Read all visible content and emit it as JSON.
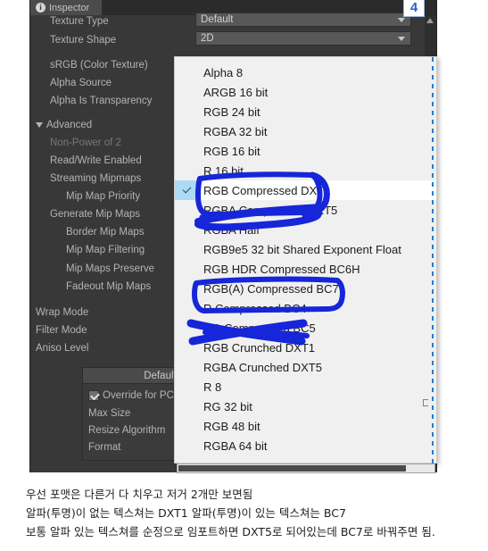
{
  "inspector": {
    "tab_label": "Inspector",
    "tab_icon": "info-icon",
    "properties": [
      {
        "label": "Texture Type",
        "value": "Default",
        "kind": "dropdown"
      },
      {
        "label": "Texture Shape",
        "value": "2D",
        "kind": "dropdown"
      },
      {
        "label": "sRGB (Color Texture)",
        "value": "",
        "kind": "checkbox"
      },
      {
        "label": "Alpha Source",
        "value": "",
        "kind": "dropdown"
      },
      {
        "label": "Alpha Is Transparency",
        "value": "",
        "kind": "checkbox"
      }
    ],
    "advanced_label": "Advanced",
    "advanced_items": [
      {
        "label": "Non-Power of 2",
        "dim": true,
        "indent": 0
      },
      {
        "label": "Read/Write Enabled",
        "dim": false,
        "indent": 0
      },
      {
        "label": "Streaming Mipmaps",
        "dim": false,
        "indent": 0
      },
      {
        "label": "Mip Map Priority",
        "dim": false,
        "indent": 1
      },
      {
        "label": "Generate Mip Maps",
        "dim": false,
        "indent": 0
      },
      {
        "label": "Border Mip Maps",
        "dim": false,
        "indent": 1
      },
      {
        "label": "Mip Map Filtering",
        "dim": false,
        "indent": 1
      },
      {
        "label": "Mip Maps Preserve",
        "dim": false,
        "indent": 1
      },
      {
        "label": "Fadeout Mip Maps",
        "dim": false,
        "indent": 1
      }
    ],
    "bottom_items": [
      {
        "label": "Wrap Mode"
      },
      {
        "label": "Filter Mode"
      },
      {
        "label": "Aniso Level"
      }
    ],
    "platform": {
      "tab_label": "Default",
      "override_label": "Override for PC, Mac",
      "rows": [
        "Max Size",
        "Resize Algorithm",
        "Format"
      ]
    }
  },
  "dropdown": {
    "items": [
      {
        "label": "Alpha 8",
        "selected": false
      },
      {
        "label": "ARGB 16 bit",
        "selected": false
      },
      {
        "label": "RGB 24 bit",
        "selected": false
      },
      {
        "label": "RGBA 32 bit",
        "selected": false
      },
      {
        "label": "RGB 16 bit",
        "selected": false
      },
      {
        "label": "R 16 bit",
        "selected": false
      },
      {
        "label": "RGB Compressed DXT1",
        "selected": true
      },
      {
        "label": "RGBA Compressed DXT5",
        "selected": false
      },
      {
        "label": "RGBA Half",
        "selected": false
      },
      {
        "label": "RGB9e5 32 bit Shared Exponent Float",
        "selected": false
      },
      {
        "label": "RGB HDR Compressed BC6H",
        "selected": false
      },
      {
        "label": "RGB(A) Compressed BC7",
        "selected": false
      },
      {
        "label": "R Compressed BC4",
        "selected": false
      },
      {
        "label": "RG Compressed BC5",
        "selected": false
      },
      {
        "label": "RGB Crunched DXT1",
        "selected": false
      },
      {
        "label": "RGBA Crunched DXT5",
        "selected": false
      },
      {
        "label": "R 8",
        "selected": false
      },
      {
        "label": "RG 32 bit",
        "selected": false
      },
      {
        "label": "RGB 48 bit",
        "selected": false
      },
      {
        "label": "RGBA 64 bit",
        "selected": false
      }
    ]
  },
  "badge": {
    "value": "4"
  },
  "annotation": {
    "color": "#1626d8",
    "marks": [
      "box-around-rgb-compressed-dxt1",
      "strikethrough-rgba-compressed-dxt5",
      "box-around-rgba-compressed-bc7",
      "strikethrough-rg-compressed-bc5"
    ]
  },
  "caption": {
    "line1": "우선 포맷은 다른거 다 치우고 저거 2개만 보면됨",
    "line2": "알파(투명)이 없는 텍스쳐는 DXT1 알파(투명)이 있는 텍스쳐는 BC7",
    "line3": "보통 알파 있는 텍스쳐를 순정으로 임포트하면 DXT5로 되어있는데 BC7로 바꿔주면 됨."
  }
}
